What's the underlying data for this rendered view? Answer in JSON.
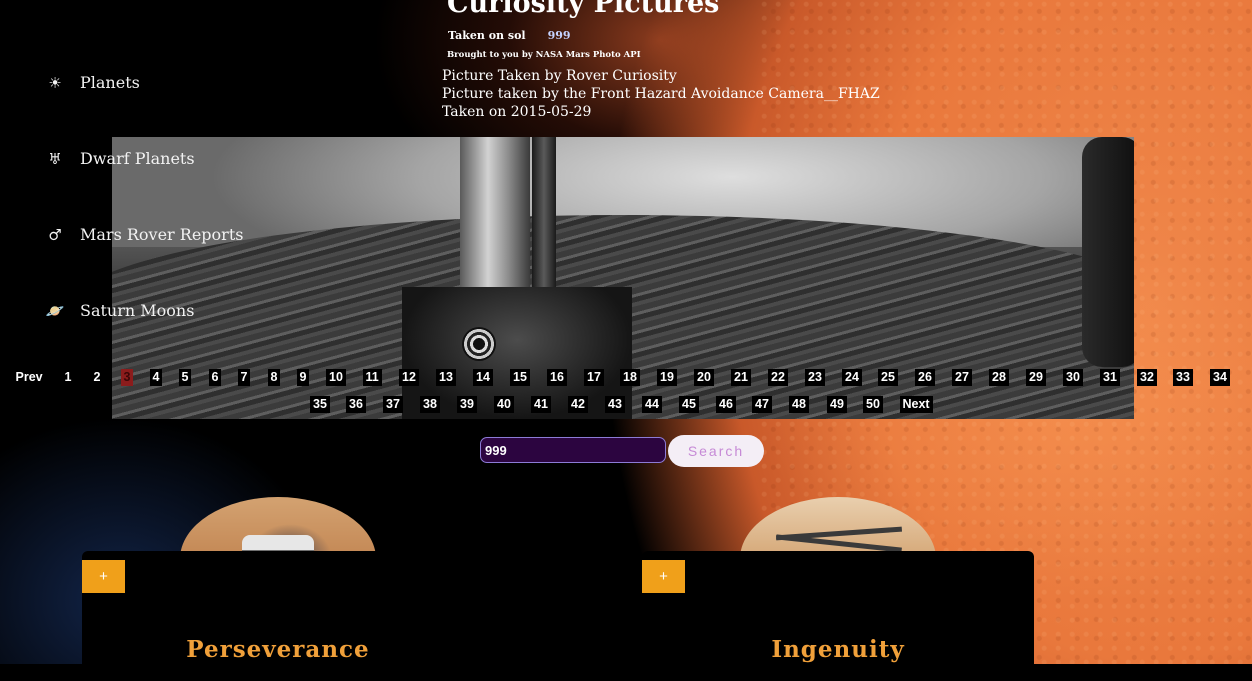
{
  "header": {
    "title": "Curiosity Pictures",
    "sol_label": "Taken on sol",
    "sol_value": "999",
    "credit": "Brought to you by NASA Mars Photo API"
  },
  "photo_info": {
    "rover_line": "Picture Taken by Rover Curiosity",
    "camera_line": "Picture taken by the Front Hazard Avoidance Camera__FHAZ",
    "date_line": "Taken on 2015-05-29"
  },
  "sidebar": {
    "items": [
      {
        "label": "Planets",
        "icon": "sun-icon"
      },
      {
        "label": "Dwarf Planets",
        "icon": "dwarf-planet-icon"
      },
      {
        "label": "Mars Rover Reports",
        "icon": "mars-symbol-icon"
      },
      {
        "label": "Saturn Moons",
        "icon": "ringed-planet-icon"
      }
    ]
  },
  "pagination": {
    "prev": "Prev",
    "next": "Next",
    "current": "3",
    "pages": [
      "1",
      "2",
      "3",
      "4",
      "5",
      "6",
      "7",
      "8",
      "9",
      "10",
      "11",
      "12",
      "13",
      "14",
      "15",
      "16",
      "17",
      "18",
      "19",
      "20",
      "21",
      "22",
      "23",
      "24",
      "25",
      "26",
      "27",
      "28",
      "29",
      "30",
      "31",
      "32",
      "33",
      "34",
      "35",
      "36",
      "37",
      "38",
      "39",
      "40",
      "41",
      "42",
      "43",
      "44",
      "45",
      "46",
      "47",
      "48",
      "49",
      "50"
    ]
  },
  "search": {
    "value": "999",
    "button_label": "Search"
  },
  "cards": [
    {
      "name": "Perseverance",
      "button_label": "+"
    },
    {
      "name": "Ingenuity",
      "button_label": "+"
    }
  ],
  "colors": {
    "accent_orange": "#f0a01a",
    "active_page": "#8b1c1c",
    "card_title": "#f0a03a",
    "search_bg": "#2c0540"
  }
}
